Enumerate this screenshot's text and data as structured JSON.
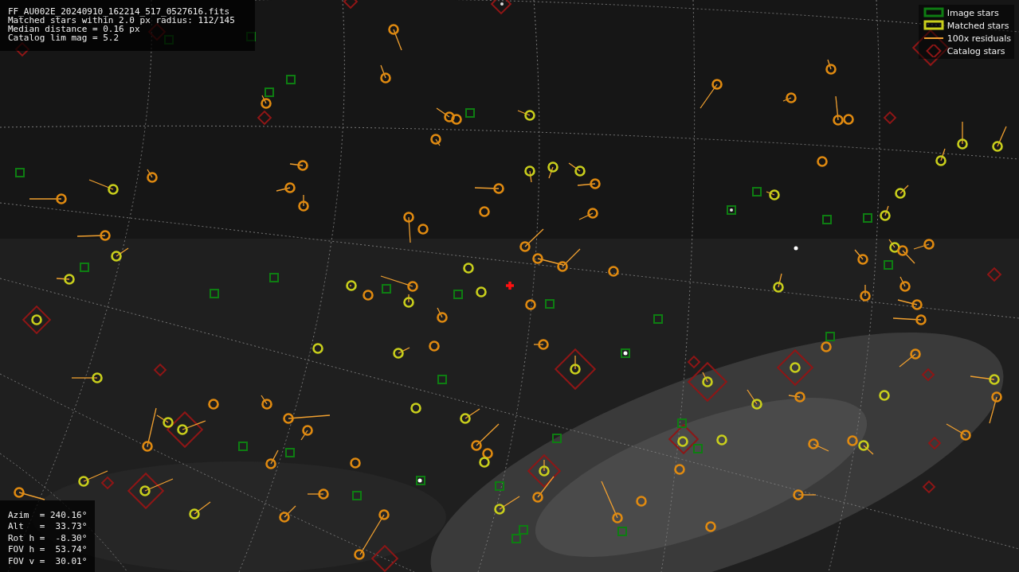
{
  "header_info": {
    "lines": [
      "FF_AU002E_20240910_162214_517_0527616.fits",
      "Matched stars within 2.0 px radius: 112/145",
      "Median distance = 0.16 px",
      "Catalog lim mag = 5.2"
    ]
  },
  "legend": [
    {
      "kind": "box",
      "label": "Image stars",
      "color": "#0e7d12"
    },
    {
      "kind": "box",
      "label": "Matched stars",
      "color": "#c9cf1c"
    },
    {
      "kind": "line",
      "label": "100x residuals",
      "color": "#f0a030"
    },
    {
      "kind": "diamond",
      "label": "Catalog stars",
      "color": "#8e1616"
    }
  ],
  "pointing_info": {
    "lines": [
      "Azim  = 240.16°",
      "Alt   =  33.73°",
      "Rot h =  -8.30°",
      "FOV h =  53.74°",
      "FOV v =  30.01°"
    ]
  }
}
